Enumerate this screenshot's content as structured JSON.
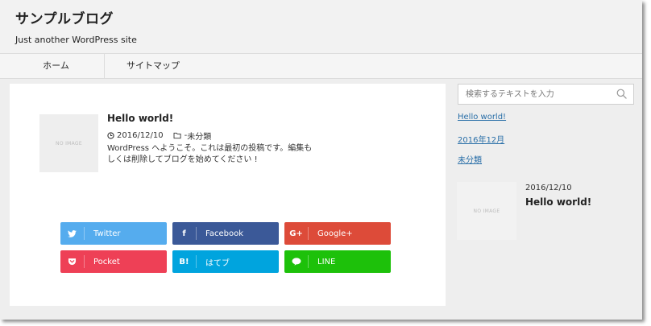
{
  "site": {
    "title": "サンプルブログ",
    "description": "Just another WordPress site"
  },
  "nav": {
    "items": [
      {
        "label": "ホーム"
      },
      {
        "label": "サイトマップ"
      }
    ]
  },
  "post": {
    "thumb_label": "NO IMAGE",
    "title": "Hello world!",
    "date": "2016/12/10",
    "category": "未分類",
    "excerpt": "WordPress へようこそ。これは最初の投稿です。編集もしくは削除してブログを始めてください !"
  },
  "share": {
    "buttons": [
      {
        "label": "Twitter",
        "icon": "twitter-icon",
        "color": "#55acee"
      },
      {
        "label": "Facebook",
        "icon": "facebook-icon",
        "color": "#3b5998",
        "glyph": "f"
      },
      {
        "label": "Google+",
        "icon": "googleplus-icon",
        "color": "#dd4b39",
        "glyph": "G+"
      },
      {
        "label": "Pocket",
        "icon": "pocket-icon",
        "color": "#ee4056"
      },
      {
        "label": "はてブ",
        "icon": "hatebu-icon",
        "color": "#00a4de",
        "glyph": "B!"
      },
      {
        "label": "LINE",
        "icon": "line-icon",
        "color": "#1dc10a"
      }
    ]
  },
  "sidebar": {
    "search": {
      "placeholder": "検索するテキストを入力",
      "value": ""
    },
    "links": [
      {
        "label": "Hello world!"
      },
      {
        "label": "2016年12月"
      },
      {
        "label": "未分類"
      }
    ],
    "recent": {
      "thumb_label": "NO IMAGE",
      "date": "2016/12/10",
      "title": "Hello world!"
    }
  }
}
